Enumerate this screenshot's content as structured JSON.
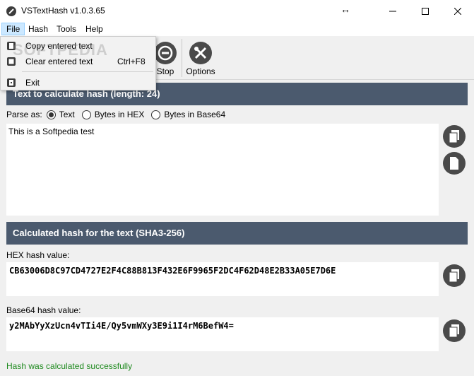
{
  "window": {
    "title": "VSTextHash v1.0.3.65"
  },
  "menu": {
    "file": "File",
    "hash": "Hash",
    "tools": "Tools",
    "help": "Help"
  },
  "file_menu": {
    "copy": "Copy entered text",
    "clear": "Clear entered text",
    "clear_shortcut": "Ctrl+F8",
    "exit": "Exit"
  },
  "toolbar": {
    "stop": "Stop",
    "options": "Options"
  },
  "input_section": {
    "header": "Text to calculate hash (length: 24)",
    "parse_label": "Parse as:",
    "options": [
      "Text",
      "Bytes in HEX",
      "Bytes in Base64"
    ],
    "selected": "Text",
    "text": "This is a Softpedia test"
  },
  "output_section": {
    "header": "Calculated hash for the text (SHA3-256)",
    "hex_label": "HEX hash value:",
    "hex_value": "CB63006D8C97CD4727E2F4C88B813F432E6F9965F2DC4F62D48E2B33A05E7D6E",
    "b64_label": "Base64 hash value:",
    "b64_value": "y2MAbYyXzUcn4vTIi4E/Qy5vmWXy3E9i1I4rM6BefW4="
  },
  "status": "Hash was calculated successfully",
  "watermark": "SOFTPEDIA",
  "colors": {
    "header_bg": "#4b5a6e",
    "status_green": "#1e8a1e",
    "menu_highlight": "#cce8ff"
  },
  "icons": {
    "app": "brush-icon",
    "stop": "stop-icon",
    "options": "tools-icon",
    "copy": "copy-icon",
    "paste": "paste-icon"
  }
}
